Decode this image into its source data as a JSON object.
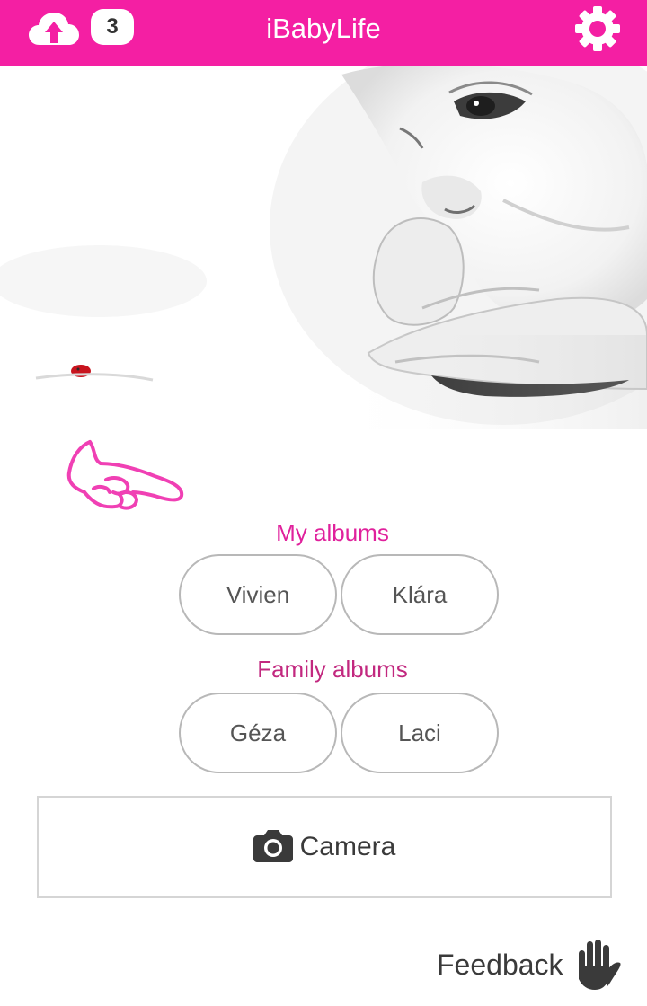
{
  "header": {
    "title": "iBabyLife",
    "upload_icon": "cloud-upload-icon",
    "upload_count": "3",
    "settings_icon": "gear-icon",
    "color": "#f41fa3"
  },
  "hero": {
    "image": "baby-sketch-photo"
  },
  "hint": {
    "icon": "pointing-hand-icon"
  },
  "my_albums": {
    "label": "My albums",
    "items": [
      {
        "label": "Vivien"
      },
      {
        "label": "Klára"
      }
    ]
  },
  "family_albums": {
    "label": "Family albums",
    "items": [
      {
        "label": "Géza"
      },
      {
        "label": "Laci"
      }
    ]
  },
  "camera": {
    "label": "Camera",
    "icon": "camera-icon"
  },
  "feedback": {
    "label": "Feedback",
    "icon": "raised-hand-icon"
  },
  "colors": {
    "accent": "#f41fa3",
    "section_my": "#e0219c",
    "section_family": "#c2287f",
    "text": "#555555"
  }
}
